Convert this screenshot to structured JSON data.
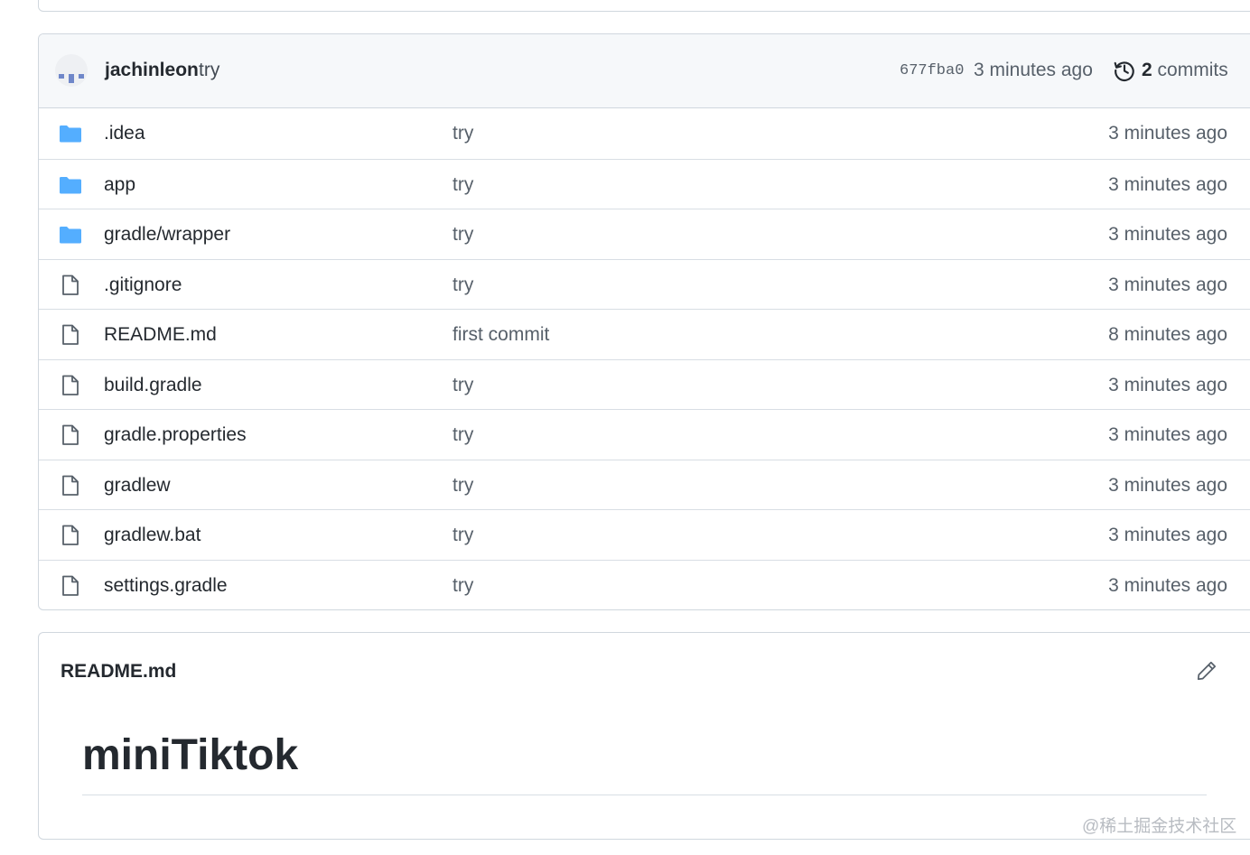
{
  "commit_bar": {
    "author": "jachinleon",
    "message": "try",
    "sha": "677fba0",
    "time": "3 minutes ago",
    "commits_count": "2",
    "commits_label": "commits"
  },
  "files": [
    {
      "type": "folder",
      "icon": "folder-icon",
      "name": ".idea",
      "commit": "try",
      "age": "3 minutes ago"
    },
    {
      "type": "folder",
      "icon": "folder-icon",
      "name": "app",
      "commit": "try",
      "age": "3 minutes ago"
    },
    {
      "type": "folder",
      "icon": "folder-icon",
      "name": "gradle/wrapper",
      "commit": "try",
      "age": "3 minutes ago"
    },
    {
      "type": "file",
      "icon": "file-icon",
      "name": ".gitignore",
      "commit": "try",
      "age": "3 minutes ago"
    },
    {
      "type": "file",
      "icon": "file-icon",
      "name": "README.md",
      "commit": "first commit",
      "age": "8 minutes ago"
    },
    {
      "type": "file",
      "icon": "file-icon",
      "name": "build.gradle",
      "commit": "try",
      "age": "3 minutes ago"
    },
    {
      "type": "file",
      "icon": "file-icon",
      "name": "gradle.properties",
      "commit": "try",
      "age": "3 minutes ago"
    },
    {
      "type": "file",
      "icon": "file-icon",
      "name": "gradlew",
      "commit": "try",
      "age": "3 minutes ago"
    },
    {
      "type": "file",
      "icon": "file-icon",
      "name": "gradlew.bat",
      "commit": "try",
      "age": "3 minutes ago"
    },
    {
      "type": "file",
      "icon": "file-icon",
      "name": "settings.gradle",
      "commit": "try",
      "age": "3 minutes ago"
    }
  ],
  "readme": {
    "title": "README.md",
    "heading": "miniTiktok"
  },
  "watermark": "@稀土掘金技术社区",
  "colors": {
    "folder": "#54aeff",
    "border": "#d0d7de",
    "muted_text": "#57606a",
    "header_bg": "#f6f8fa"
  }
}
